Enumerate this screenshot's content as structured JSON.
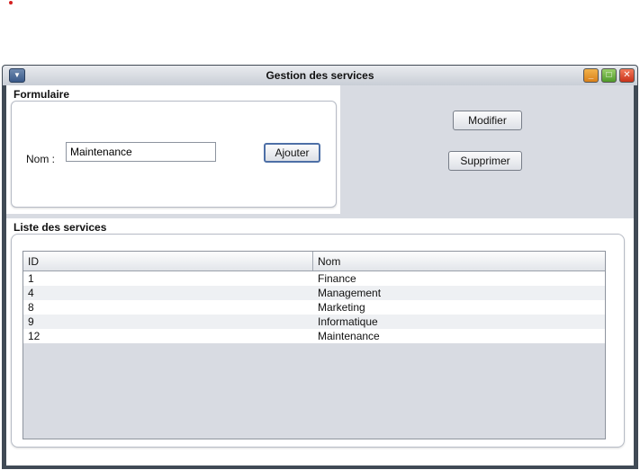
{
  "window": {
    "title": "Gestion des services",
    "menu_icon": "chevron-down-icon",
    "controls": {
      "minimize": "_",
      "maximize": "□",
      "close": "✕"
    }
  },
  "form": {
    "title": "Formulaire",
    "nom_label": "Nom :",
    "nom_value": "Maintenance",
    "add_label": "Ajouter"
  },
  "actions": {
    "modify_label": "Modifier",
    "delete_label": "Supprimer"
  },
  "list": {
    "title": "Liste des services",
    "columns": [
      "ID",
      "Nom"
    ],
    "rows": [
      {
        "id": "1",
        "nom": "Finance"
      },
      {
        "id": "4",
        "nom": "Management"
      },
      {
        "id": "8",
        "nom": "Marketing"
      },
      {
        "id": "9",
        "nom": "Informatique"
      },
      {
        "id": "12",
        "nom": "Maintenance"
      }
    ]
  },
  "colors": {
    "panel_bg": "#d8dbe2",
    "window_frame": "#404a55",
    "default_button_border": "#4d6fa6"
  }
}
